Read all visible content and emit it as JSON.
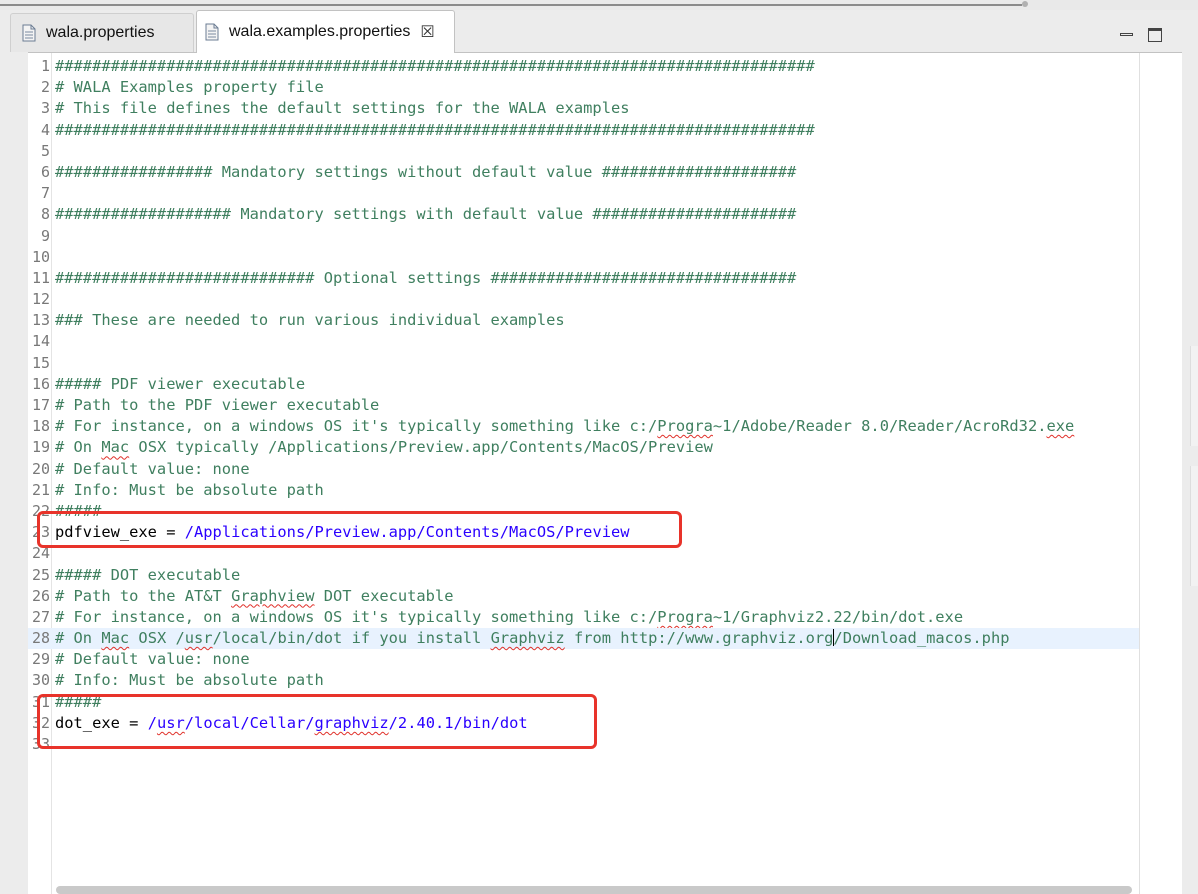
{
  "tabs": [
    {
      "label": "wala.properties",
      "active": false
    },
    {
      "label": "wala.examples.properties",
      "active": true,
      "close_glyph": "☒"
    }
  ],
  "window_controls": {
    "minimize_icon": "minimize-icon",
    "maximize_icon": "maximize-icon"
  },
  "editor": {
    "current_line": 28,
    "lines": [
      {
        "n": "1",
        "text": "##################################################################################"
      },
      {
        "n": "2",
        "text": "# WALA Examples property file"
      },
      {
        "n": "3",
        "text": "# This file defines the default settings for the WALA examples"
      },
      {
        "n": "4",
        "text": "##################################################################################"
      },
      {
        "n": "5",
        "text": ""
      },
      {
        "n": "6",
        "text": "################# Mandatory settings without default value #####################"
      },
      {
        "n": "7",
        "text": ""
      },
      {
        "n": "8",
        "text": "################### Mandatory settings with default value ######################"
      },
      {
        "n": "9",
        "text": ""
      },
      {
        "n": "10",
        "text": ""
      },
      {
        "n": "11",
        "text": "############################ Optional settings #################################"
      },
      {
        "n": "12",
        "text": ""
      },
      {
        "n": "13",
        "text": "### These are needed to run various individual examples"
      },
      {
        "n": "14",
        "text": ""
      },
      {
        "n": "15",
        "text": ""
      },
      {
        "n": "16",
        "text": "##### PDF viewer executable"
      },
      {
        "n": "17",
        "text": "# Path to the PDF viewer executable"
      },
      {
        "n": "18",
        "pre": "# For instance, on a windows OS it's typically something like c:/",
        "sq": "Progra",
        "post": "~1/Adobe/Reader 8.0/Reader/AcroRd32.",
        "sq2": "exe"
      },
      {
        "n": "19",
        "pre": "# On ",
        "sq": "Mac",
        "post": " OSX typically /Applications/Preview.app/Contents/MacOS/Preview"
      },
      {
        "n": "20",
        "text": "# Default value: none"
      },
      {
        "n": "21",
        "text": "# Info: Must be absolute path"
      },
      {
        "n": "22",
        "text": "#####"
      },
      {
        "n": "23",
        "key": "pdfview_exe",
        "eq": " = ",
        "val": "/Applications/Preview.app/Contents/MacOS/Preview"
      },
      {
        "n": "24",
        "text": ""
      },
      {
        "n": "25",
        "text": "##### DOT executable"
      },
      {
        "n": "26",
        "pre": "# Path to the AT&T ",
        "sq": "Graphview",
        "post": " DOT executable"
      },
      {
        "n": "27",
        "pre": "# For instance, on a windows OS it's typically something like c:/",
        "sq": "Progra",
        "post": "~1/Graphviz2.22/bin/dot.exe"
      },
      {
        "n": "28",
        "pre": "# On ",
        "sq": "Mac",
        "post": " OSX /",
        "sq2": "usr",
        "post2": "/local/bin/dot if you install ",
        "sq3": "Graphviz",
        "post3": " from http://www.graphviz.org",
        "caret": true,
        "post4": "/Download_macos.php"
      },
      {
        "n": "29",
        "text": "# Default value: none"
      },
      {
        "n": "30",
        "text": "# Info: Must be absolute path"
      },
      {
        "n": "31",
        "text": "#####"
      },
      {
        "n": "32",
        "key": "dot_exe",
        "eq": " = ",
        "val_pre": "/",
        "val_sq": "usr",
        "val_mid": "/local/Cellar/",
        "val_sq2": "graphviz",
        "val_post": "/2.40.1/bin/dot"
      },
      {
        "n": "33",
        "text": ""
      }
    ]
  }
}
